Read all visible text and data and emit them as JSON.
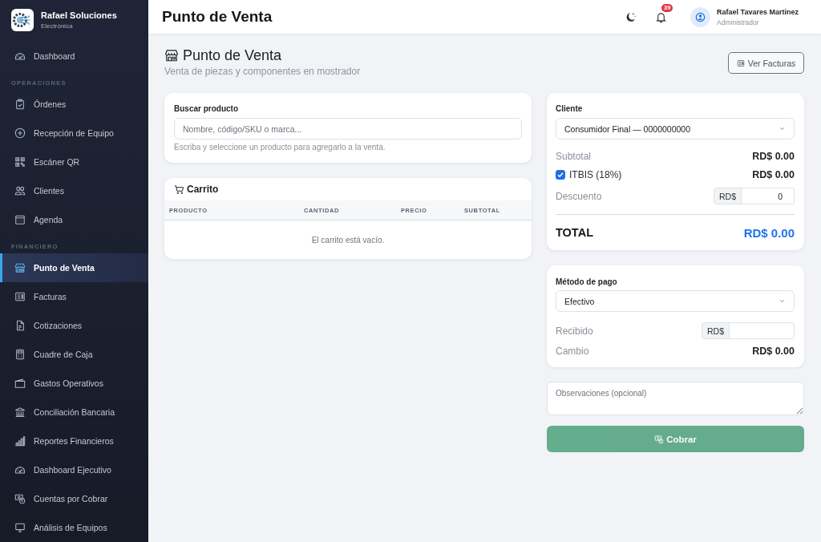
{
  "sidebar": {
    "brand": {
      "name": "Rafael Soluciones",
      "tagline": "Electrónica"
    },
    "sections": [
      {
        "items": [
          {
            "label": "Dashboard",
            "selected": false
          }
        ]
      },
      {
        "heading": "OPERACIONES",
        "items": [
          {
            "label": "Órdenes",
            "selected": false
          },
          {
            "label": "Recepción de Equipo",
            "selected": false
          },
          {
            "label": "Escáner QR",
            "selected": false
          },
          {
            "label": "Clientes",
            "selected": false
          },
          {
            "label": "Agenda",
            "selected": false
          }
        ]
      },
      {
        "heading": "FINANCIERO",
        "items": [
          {
            "label": "Punto de Venta",
            "selected": true
          },
          {
            "label": "Facturas",
            "selected": false
          },
          {
            "label": "Cotizaciones",
            "selected": false
          },
          {
            "label": "Cuadre de Caja",
            "selected": false
          },
          {
            "label": "Gastos Operativos",
            "selected": false
          },
          {
            "label": "Conciliación Bancaria",
            "selected": false
          },
          {
            "label": "Reportes Financieros",
            "selected": false
          },
          {
            "label": "Dashboard Ejecutivo",
            "selected": false
          },
          {
            "label": "Cuentas por Cobrar",
            "selected": false
          },
          {
            "label": "Análisis de Equipos",
            "selected": false
          }
        ]
      }
    ]
  },
  "topbar": {
    "title": "Punto de Venta",
    "notification_count": "39",
    "user": {
      "name": "Rafael Tavares Martinez",
      "role": "Administrador"
    }
  },
  "page": {
    "title": "Punto de Venta",
    "subtitle": "Venta de piezas y componentes en mostrador",
    "action": "Ver Facturas"
  },
  "search": {
    "label": "Buscar producto",
    "placeholder": "Nombre, código/SKU o marca...",
    "hint": "Escriba y seleccione un producto para agregarlo a la venta."
  },
  "cart": {
    "title": "Carrito",
    "columns": [
      "PRODUCTO",
      "CANTIDAD",
      "PRECIO",
      "SUBTOTAL"
    ],
    "empty_message": "El carrito está vacío."
  },
  "summary": {
    "client": {
      "label": "Cliente",
      "value": "Consumidor Final — 0000000000"
    },
    "subtotal": {
      "label": "Subtotal",
      "value": "RD$ 0.00"
    },
    "tax": {
      "label": "ITBIS (18%)",
      "checked": true,
      "value": "RD$ 0.00"
    },
    "discount": {
      "label": "Descuento",
      "prefix": "RD$",
      "value": "0"
    },
    "total": {
      "label": "TOTAL",
      "value": "RD$ 0.00"
    }
  },
  "payment": {
    "method": {
      "label": "Método de pago",
      "value": "Efectivo"
    },
    "received": {
      "label": "Recibido",
      "prefix": "RD$"
    },
    "change": {
      "label": "Cambio",
      "value": "RD$ 0.00"
    }
  },
  "notes": {
    "placeholder": "Observaciones (opcional)"
  },
  "charge_button": {
    "label": "Cobrar",
    "disabled": true
  }
}
